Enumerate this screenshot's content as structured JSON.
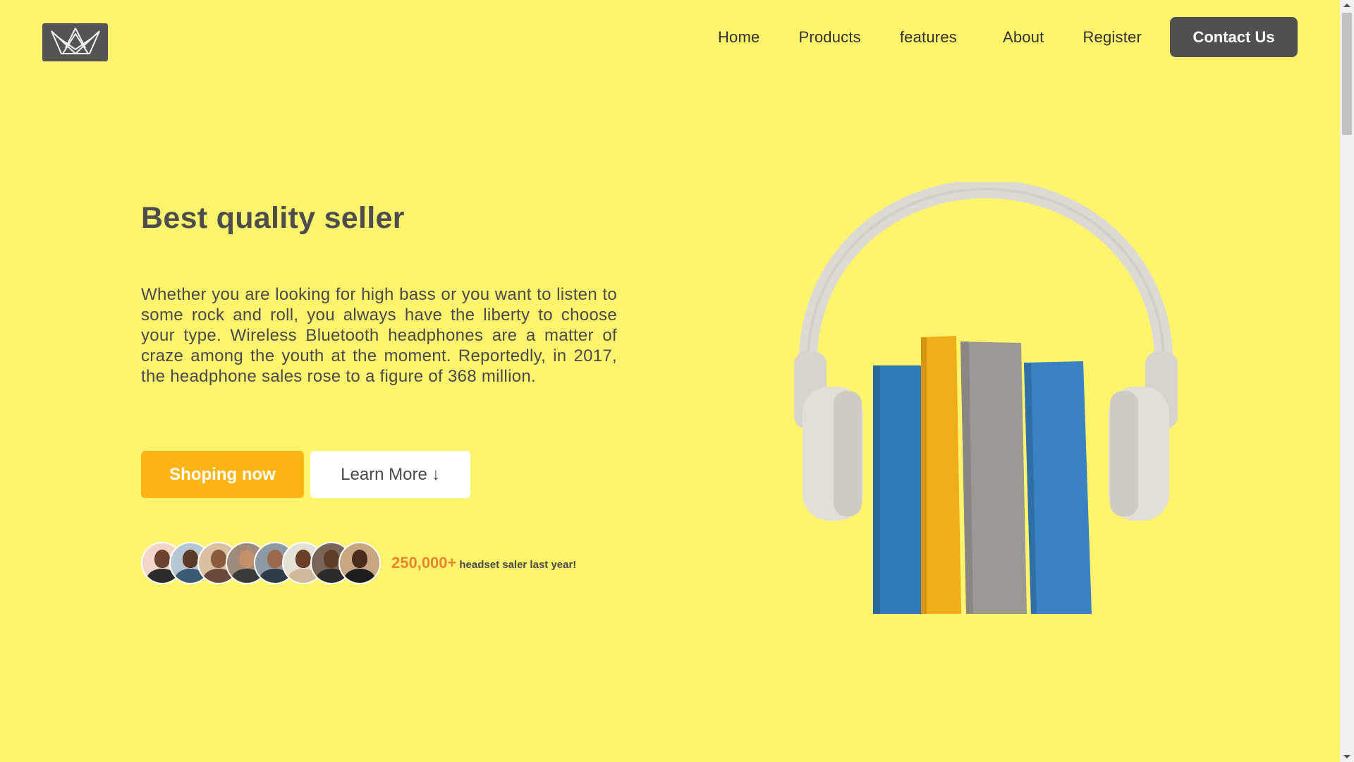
{
  "nav": {
    "logo_icon": "crown-logo-icon",
    "links": [
      "Home",
      "Products",
      "features",
      "About",
      "Register"
    ],
    "contact_label": "Contact Us"
  },
  "hero": {
    "title": "Best quality seller",
    "description": "Whether you are looking for high bass or you want to listen to some rock and roll, you always have the liberty to choose your type. Wireless Bluetooth headphones are a matter of craze among the youth at the moment. Reportedly, in 2017, the headphone sales rose to a figure of 368 million.",
    "shop_label": "Shoping now",
    "learn_label": "Learn More",
    "learn_arrow": "↓",
    "stat_number": "250,000+",
    "stat_label": "headset saler last year!",
    "image_icon": "headphones-on-books-image"
  },
  "colors": {
    "background": "#fff46e",
    "primary_dark": "#505050",
    "accent_yellow": "#fdb515",
    "stat_orange": "#e8862a",
    "text_dark": "#4d4d4d"
  }
}
